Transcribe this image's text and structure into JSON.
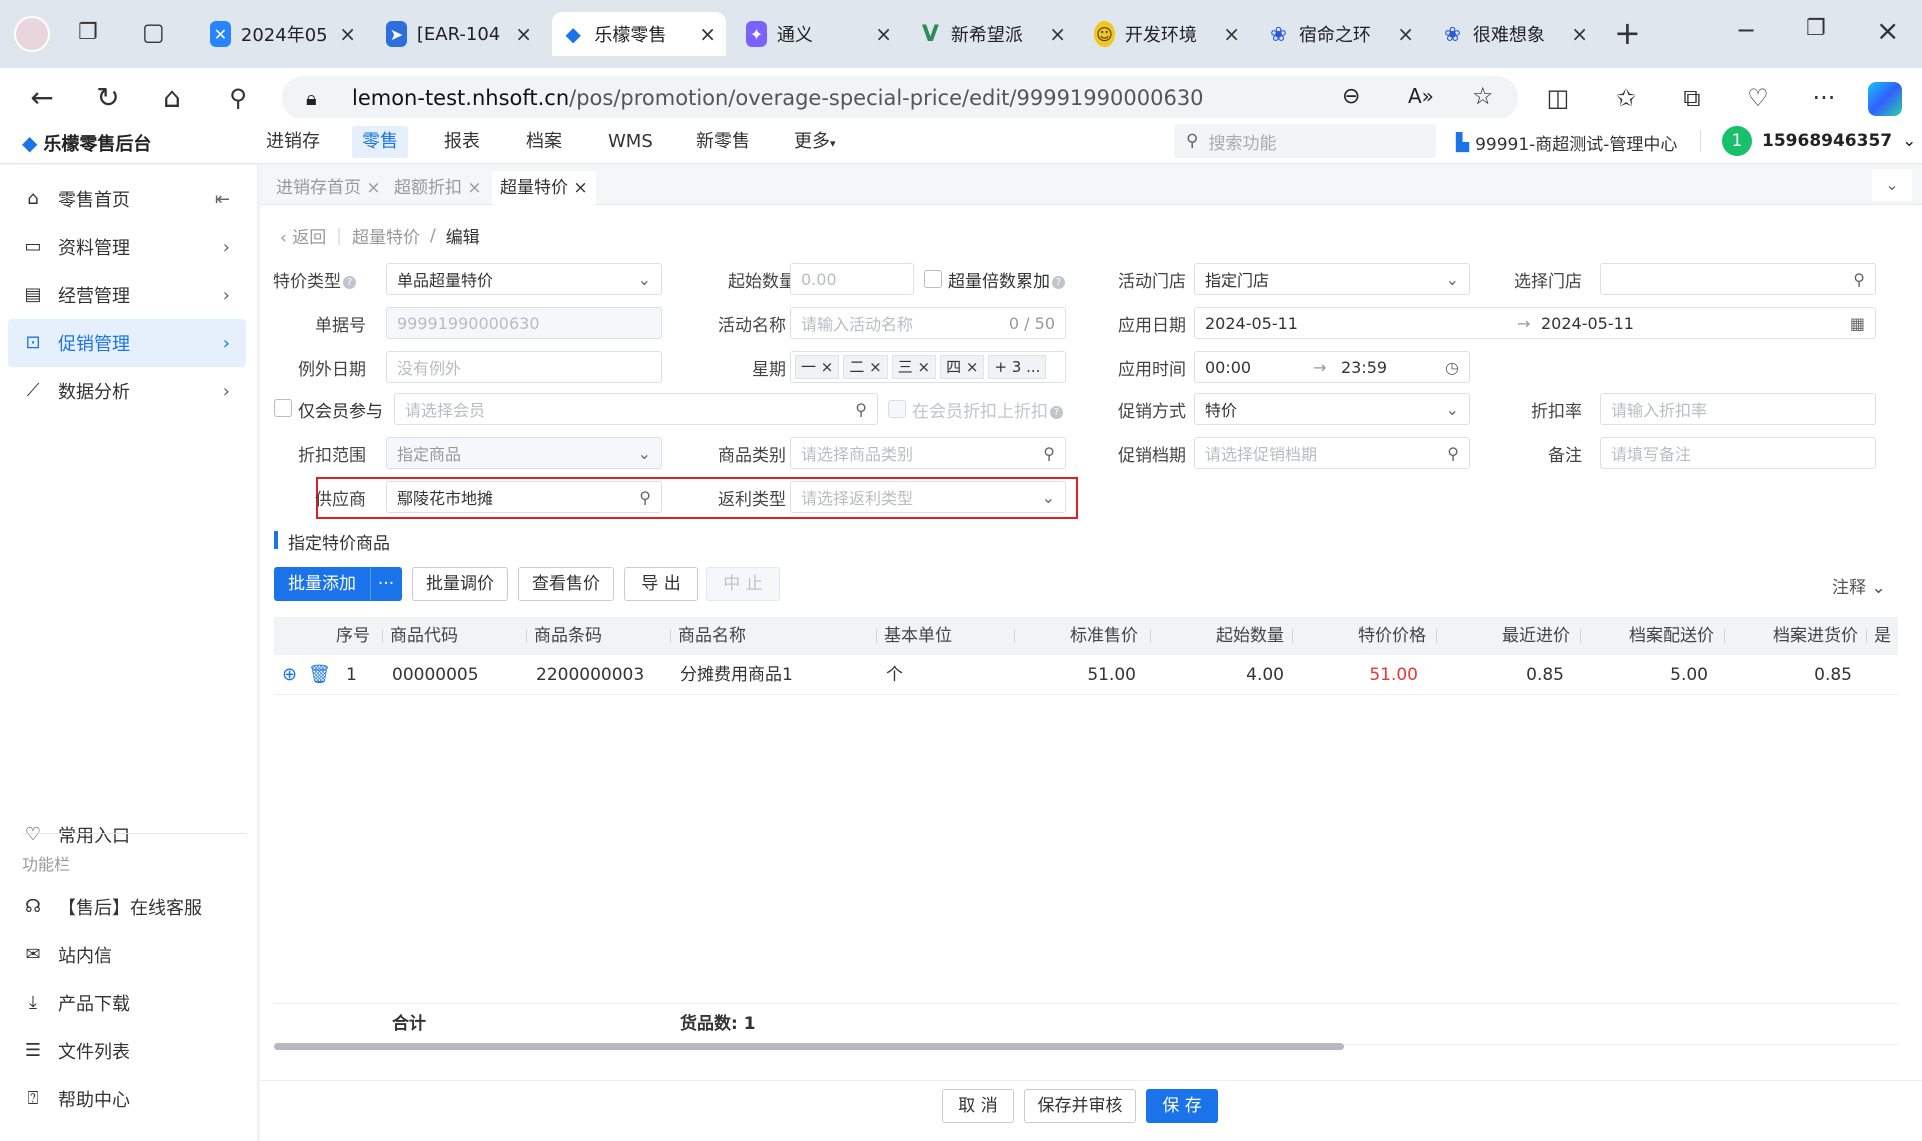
{
  "browser": {
    "tabs": [
      {
        "label": "2024年05",
        "icon": "confluence-icon"
      },
      {
        "label": "[EAR-104",
        "icon": "jira-icon"
      },
      {
        "label": "乐檬零售",
        "icon": "lemon-icon",
        "active": true
      },
      {
        "label": "通义",
        "icon": "tongyi-icon"
      },
      {
        "label": "新希望派",
        "icon": "vue-icon"
      },
      {
        "label": "开发环境",
        "icon": "smiley-icon"
      },
      {
        "label": "宿命之环",
        "icon": "baidu-icon"
      },
      {
        "label": "很难想象",
        "icon": "baidu-icon"
      }
    ],
    "url_host": "lemon-test.nhsoft.cn",
    "url_path": "/pos/promotion/overage-special-price/edit/99991990000630"
  },
  "app": {
    "logo": "乐檬零售后台",
    "nav": [
      "进销存",
      "零售",
      "报表",
      "档案",
      "WMS",
      "新零售",
      "更多"
    ],
    "search_placeholder": "搜索功能",
    "store": "99991-商超测试-管理中心",
    "avatar_text": "1",
    "user": "15968946357"
  },
  "sidebar": {
    "items": [
      "零售首页",
      "资料管理",
      "经营管理",
      "促销管理",
      "数据分析"
    ],
    "bottom_items": [
      "常用入口"
    ],
    "section_label": "功能栏",
    "tools": [
      "【售后】在线客服",
      "站内信",
      "产品下载",
      "文件列表",
      "帮助中心"
    ]
  },
  "page_tabs": [
    "进销存首页",
    "超额折扣",
    "超量特价"
  ],
  "breadcrumb": {
    "back": "返回",
    "parent": "超量特价",
    "sep": "/",
    "current": "编辑"
  },
  "form": {
    "special_type_label": "特价类型",
    "special_type_value": "单品超量特价",
    "start_qty_label": "起始数量",
    "start_qty_placeholder": "0.00",
    "multiple_accum_label": "超量倍数累加",
    "store_label": "活动门店",
    "store_value": "指定门店",
    "select_store_label": "选择门店",
    "order_no_label": "单据号",
    "order_no_value": "99991990000630",
    "activity_name_label": "活动名称",
    "activity_name_placeholder": "请输入活动名称",
    "activity_name_count": "0 / 50",
    "apply_date_label": "应用日期",
    "date_start": "2024-05-11",
    "date_arrow": "→",
    "date_end": "2024-05-11",
    "exclude_date_label": "例外日期",
    "exclude_date_placeholder": "没有例外",
    "weekday_label": "星期",
    "weekdays": [
      "一",
      "二",
      "三",
      "四"
    ],
    "weekdays_more": "+ 3 ...",
    "apply_time_label": "应用时间",
    "time_start": "00:00",
    "time_end": "23:59",
    "member_only_label": "仅会员参与",
    "member_placeholder": "请选择会员",
    "member_discount_label": "在会员折扣上折扣",
    "promo_method_label": "促销方式",
    "promo_method_value": "特价",
    "discount_rate_label": "折扣率",
    "discount_rate_placeholder": "请输入折扣率",
    "scope_label": "折扣范围",
    "scope_value": "指定商品",
    "category_label": "商品类别",
    "category_placeholder": "请选择商品类别",
    "promo_file_label": "促销档期",
    "promo_file_placeholder": "请选择促销档期",
    "remark_label": "备注",
    "remark_placeholder": "请填写备注",
    "supplier_label": "供应商",
    "supplier_value": "鄢陵花市地摊",
    "rebate_type_label": "返利类型",
    "rebate_type_placeholder": "请选择返利类型"
  },
  "section_title": "指定特价商品",
  "toolbar": {
    "batch_add": "批量添加",
    "more": "···",
    "batch_price": "批量调价",
    "view_price": "查看售价",
    "export": "导 出",
    "stop": "中 止",
    "note": "注释"
  },
  "table": {
    "headers": [
      "序号",
      "商品代码",
      "商品条码",
      "商品名称",
      "基本单位",
      "标准售价",
      "起始数量",
      "特价价格",
      "最近进价",
      "档案配送价",
      "档案进货价",
      "是"
    ],
    "rows": [
      [
        "1",
        "00000005",
        "2200000003",
        "分摊费用商品1",
        "个",
        "51.00",
        "4.00",
        "51.00",
        "0.85",
        "5.00",
        "0.85"
      ]
    ],
    "footer_total": "合计",
    "footer_count": "货品数: 1"
  },
  "footer_buttons": {
    "cancel": "取 消",
    "save_audit": "保存并审核",
    "save": "保 存"
  },
  "colors": {
    "accent": "#1a73e8",
    "highlight_box": "#e02020",
    "special_price": "#e53935"
  }
}
